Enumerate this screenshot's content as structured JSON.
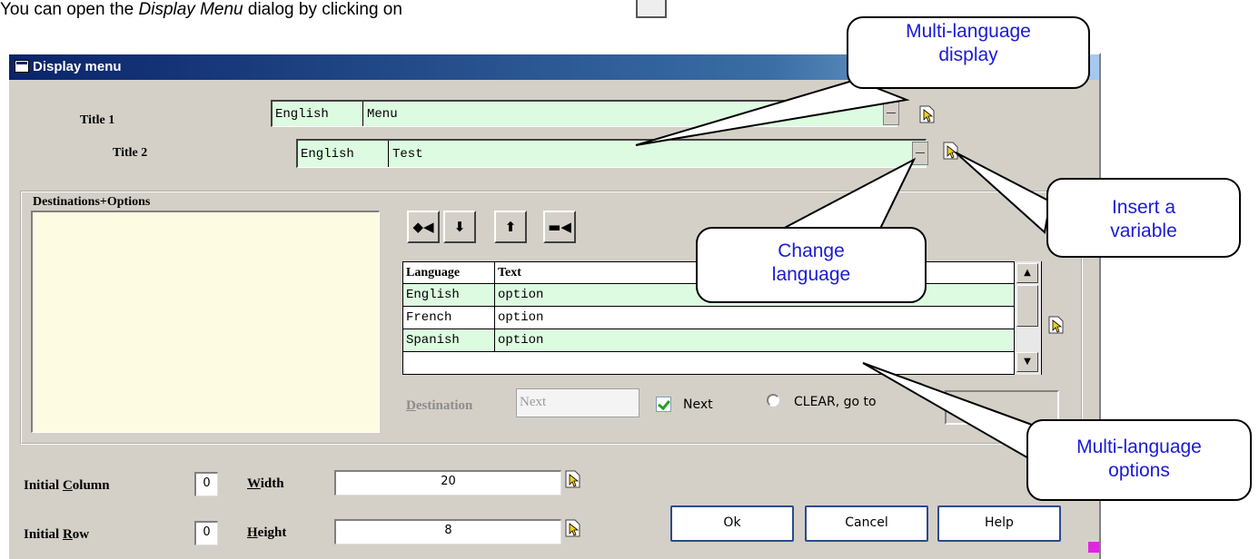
{
  "intro": {
    "text": "You can open the ",
    "emphasis": "Display Menu",
    "text_after": " dialog by clicking on"
  },
  "dialog": {
    "title": "Display menu"
  },
  "title1": {
    "label": "Title 1",
    "language": "English",
    "value": "Menu"
  },
  "title2": {
    "label": "Title 2",
    "language": "English",
    "value": "Test"
  },
  "group": {
    "label": "Destinations+Options"
  },
  "toolbar": [
    {
      "glyph": "◆◀",
      "icon": "insert-icon"
    },
    {
      "glyph": "⬇",
      "icon": "move-down-icon"
    },
    {
      "glyph": "⬆",
      "icon": "move-up-icon"
    },
    {
      "glyph": "▬◀",
      "icon": "delete-icon"
    }
  ],
  "grid": {
    "headers": [
      "Language",
      "Text"
    ],
    "rows": [
      {
        "language": "English",
        "text": "option"
      },
      {
        "language": "French",
        "text": "option"
      },
      {
        "language": "Spanish",
        "text": "option"
      }
    ]
  },
  "destination": {
    "label_first": "D",
    "label_rest": "estination",
    "value": "Next",
    "next_label": "Next",
    "next_checked": true,
    "clear_label": "CLEAR, go to"
  },
  "bottom": {
    "initial_column_label_a": "Initial ",
    "initial_column_label_u": "C",
    "initial_column_label_b": "olumn",
    "initial_column": "0",
    "initial_row_label_a": "Initial ",
    "initial_row_label_u": "R",
    "initial_row_label_b": "ow",
    "initial_row": "0",
    "width_label_u": "W",
    "width_label_rest": "idth",
    "width": "20",
    "height_label_u": "H",
    "height_label_rest": "eight",
    "height": "8"
  },
  "buttons": {
    "ok": "Ok",
    "cancel": "Cancel",
    "help": "Help"
  },
  "callouts": {
    "multi_display": [
      "Multi-language",
      "display"
    ],
    "insert_variable": [
      "Insert a",
      "variable"
    ],
    "change_language": [
      "Change",
      "language"
    ],
    "multi_options": [
      "Multi-language",
      "options"
    ]
  },
  "colors": {
    "field_green": "#ddfbe0",
    "list_cream": "#fdfbe2",
    "callout_text": "#1a1adb",
    "titlebar": "#0a246a"
  }
}
